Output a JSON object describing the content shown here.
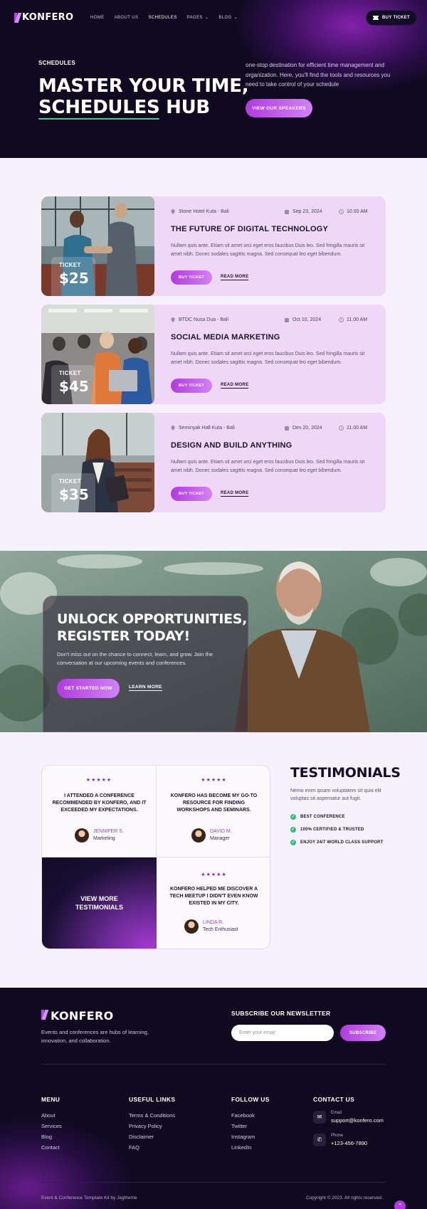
{
  "brand": {
    "name": "KONFERO"
  },
  "nav": {
    "items": [
      {
        "label": "HOME",
        "dropdown": false
      },
      {
        "label": "ABOUT US",
        "dropdown": false
      },
      {
        "label": "SCHEDULES",
        "dropdown": false,
        "active": true
      },
      {
        "label": "PAGES",
        "dropdown": true
      },
      {
        "label": "BLOG",
        "dropdown": true
      }
    ],
    "buy_ticket": "BUY TICKET"
  },
  "hero": {
    "eyebrow": "SCHEDULES",
    "title_line1": "MASTER YOUR TIME,",
    "title_underlined": "SCHEDULES",
    "title_rest": " HUB",
    "description": "one-stop destination for efficient time management and organization. Here, you'll find the tools and resources you need to take control of your schedule",
    "cta": "VIEW OUR SPEAKERS"
  },
  "schedules": [
    {
      "location": "Stone Hotel Kuta - Bali",
      "date": "Sep 23, 2024",
      "time": "10.00 AM",
      "title": "THE FUTURE OF DIGITAL TECHNOLOGY",
      "description": "Nullam quis ante. Etiam sit amet orci eget eros faucibus Duis leo. Sed fringilla mauris sit amet nibh. Donec sodales sagittis magna. Sed consequat leo eget bibendum.",
      "ticket_label": "TICKET",
      "price": "$25",
      "buy": "BUY TICKET",
      "more": "READ MORE"
    },
    {
      "location": "BTDC Nusa Dua - Bali",
      "date": "Oct 10, 2024",
      "time": "11.00 AM",
      "title": "SOCIAL MEDIA MARKETING",
      "description": "Nullam quis ante. Etiam sit amet orci eget eros faucibus Duis leo. Sed fringilla mauris sit amet nibh. Donec sodales sagittis magna. Sed consequat leo eget bibendum.",
      "ticket_label": "TICKET",
      "price": "$45",
      "buy": "BUY TICKET",
      "more": "READ MORE"
    },
    {
      "location": "Seminyak Hall Kuta - Bali",
      "date": "Des 20, 2024",
      "time": "11.00 AM",
      "title": "DESIGN AND BUILD ANYTHING",
      "description": "Nullam quis ante. Etiam sit amet orci eget eros faucibus Duis leo. Sed fringilla mauris sit amet nibh. Donec sodales sagittis magna. Sed consequat leo eget bibendum.",
      "ticket_label": "TICKET",
      "price": "$35",
      "buy": "BUY TICKET",
      "more": "READ MORE"
    }
  ],
  "banner": {
    "title_line1": "UNLOCK OPPORTUNITIES,",
    "title_line2": "REGISTER TODAY!",
    "description": "Don't miss out on the chance to connect, learn, and grow. Join the conversation at our upcoming events and conferences.",
    "cta": "GET STARTED NOW",
    "link": "LEARN MORE"
  },
  "testimonials": {
    "heading": "TESTIMONIALS",
    "description": "Nemo enim ipsam voluptatem sit quia elit voluptas sit aspernatur aut fugit.",
    "checklist": [
      "BEST CONFERENCE",
      "100% CERTIFIED & TRUSTED",
      "ENJOY 24/7 WORLD CLASS SUPPORT"
    ],
    "items": [
      {
        "stars": "★★★★★",
        "quote": "I ATTENDED A CONFERENCE RECOMMENDED BY KONFERO, AND IT EXCEEDED MY EXPECTATIONS.",
        "name": "JENNIFER S.",
        "role": "Marketing"
      },
      {
        "stars": "★★★★★",
        "quote": "KONFERO HAS BECOME MY GO-TO RESOURCE FOR FINDING WORKSHOPS AND SEMINARS.",
        "name": "DAVID M.",
        "role": "Manager"
      },
      {
        "stars": "★★★★★",
        "quote": "KONFERO HELPED ME DISCOVER A TECH MEETUP I DIDN'T EVEN KNOW EXISTED IN MY CITY.",
        "name": "LINDA R.",
        "role": "Tech Enthusiast"
      }
    ],
    "view_more": "VIEW MORE TESTIMONIALS"
  },
  "footer": {
    "tagline": "Events and conferences are hubs of learning, innovation, and collaboration.",
    "newsletter": {
      "heading": "SUBSCRIBE OUR NEWSLETTER",
      "placeholder": "Enter your email",
      "button": "SUBSCRIBE"
    },
    "menu": {
      "heading": "MENU",
      "links": [
        "About",
        "Services",
        "Blog",
        "Contact"
      ]
    },
    "useful": {
      "heading": "USEFUL LINKS",
      "links": [
        "Terms & Conditions",
        "Privacy Policy",
        "Disclaimer",
        "FAQ"
      ]
    },
    "follow": {
      "heading": "FOLLOW US",
      "links": [
        "Facebook",
        "Twitter",
        "Instagram",
        "LinkedIn"
      ]
    },
    "contact": {
      "heading": "CONTACT US",
      "email_label": "Email",
      "email": "support@konfero.com",
      "phone_label": "Phone",
      "phone": "+123-456-7890"
    },
    "credit": "Event & Conference Template Kit by Jegtheme",
    "copyright": "Copyright © 2023. All rights reserved."
  },
  "colors": {
    "accent": "#b13bdf",
    "dark": "#0f0a20",
    "card": "#efd8f7",
    "check": "#2fc07a"
  }
}
